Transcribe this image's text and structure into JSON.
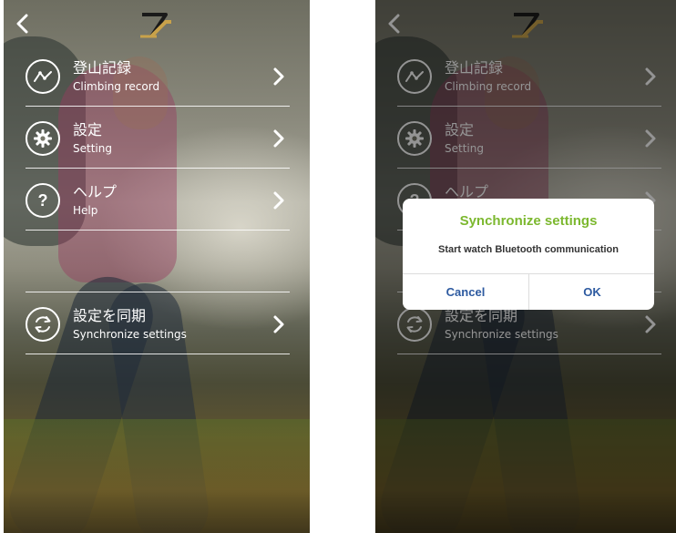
{
  "menu": {
    "items": [
      {
        "label_ja": "登山記録",
        "label_en": "Climbing record",
        "icon": "activity-chart-icon"
      },
      {
        "label_ja": "設定",
        "label_en": "Setting",
        "icon": "gear-icon"
      },
      {
        "label_ja": "ヘルプ",
        "label_en": "Help",
        "icon": "question-icon"
      },
      {
        "label_ja": "設定を同期",
        "label_en": "Synchronize settings",
        "icon": "sync-icon"
      }
    ]
  },
  "dialog": {
    "title": "Synchronize settings",
    "message": "Start watch Bluetooth communication",
    "cancel_label": "Cancel",
    "ok_label": "OK"
  },
  "colors": {
    "dialog_title": "#7cb82f",
    "dialog_button": "#2d5aa0",
    "text": "#ffffff",
    "logo_gold": "#c9a24a"
  }
}
